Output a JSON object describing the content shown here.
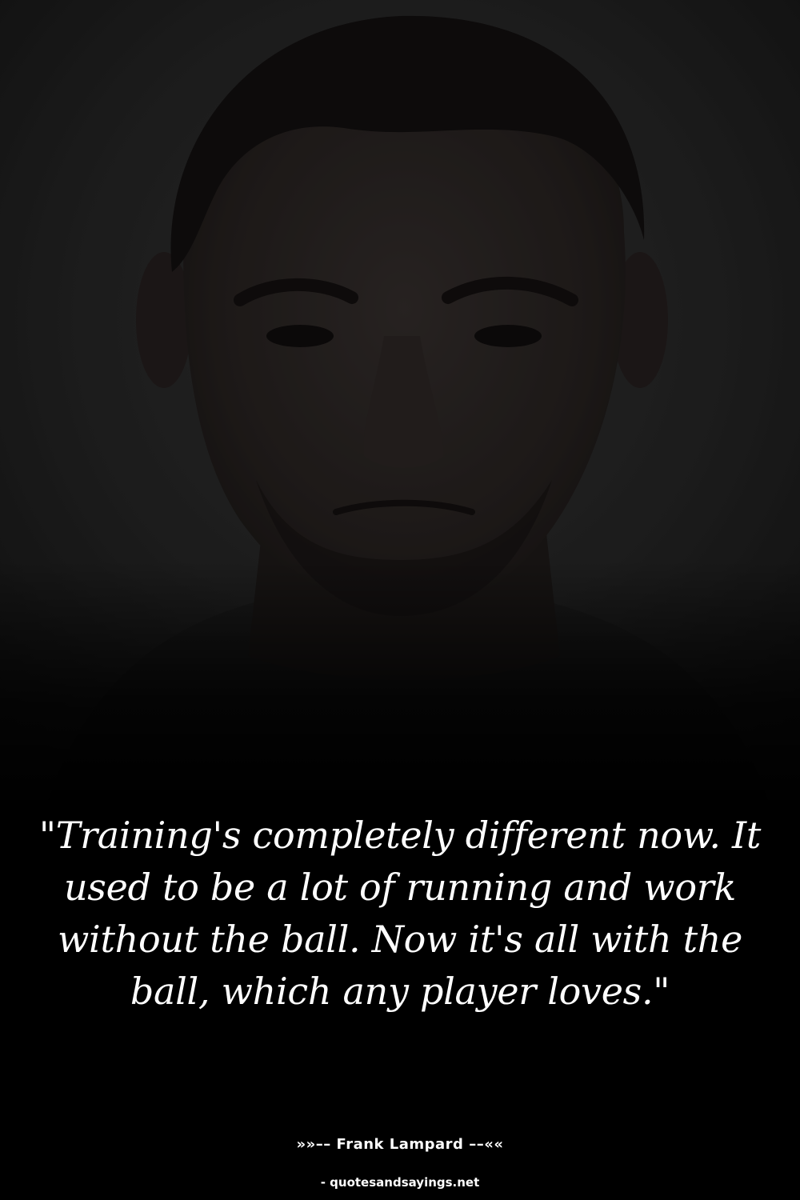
{
  "quote": {
    "text": "\"Training's completely different now. It used to be a lot of running and work without the ball. Now it's all with the ball, which any player loves.\""
  },
  "author": {
    "line": "»»–– Frank Lampard ––««"
  },
  "source": {
    "line": "- quotesandsayings.net"
  },
  "colors": {
    "background": "#000000",
    "text": "#ffffff",
    "photo_tint": "#2b2b2b"
  }
}
